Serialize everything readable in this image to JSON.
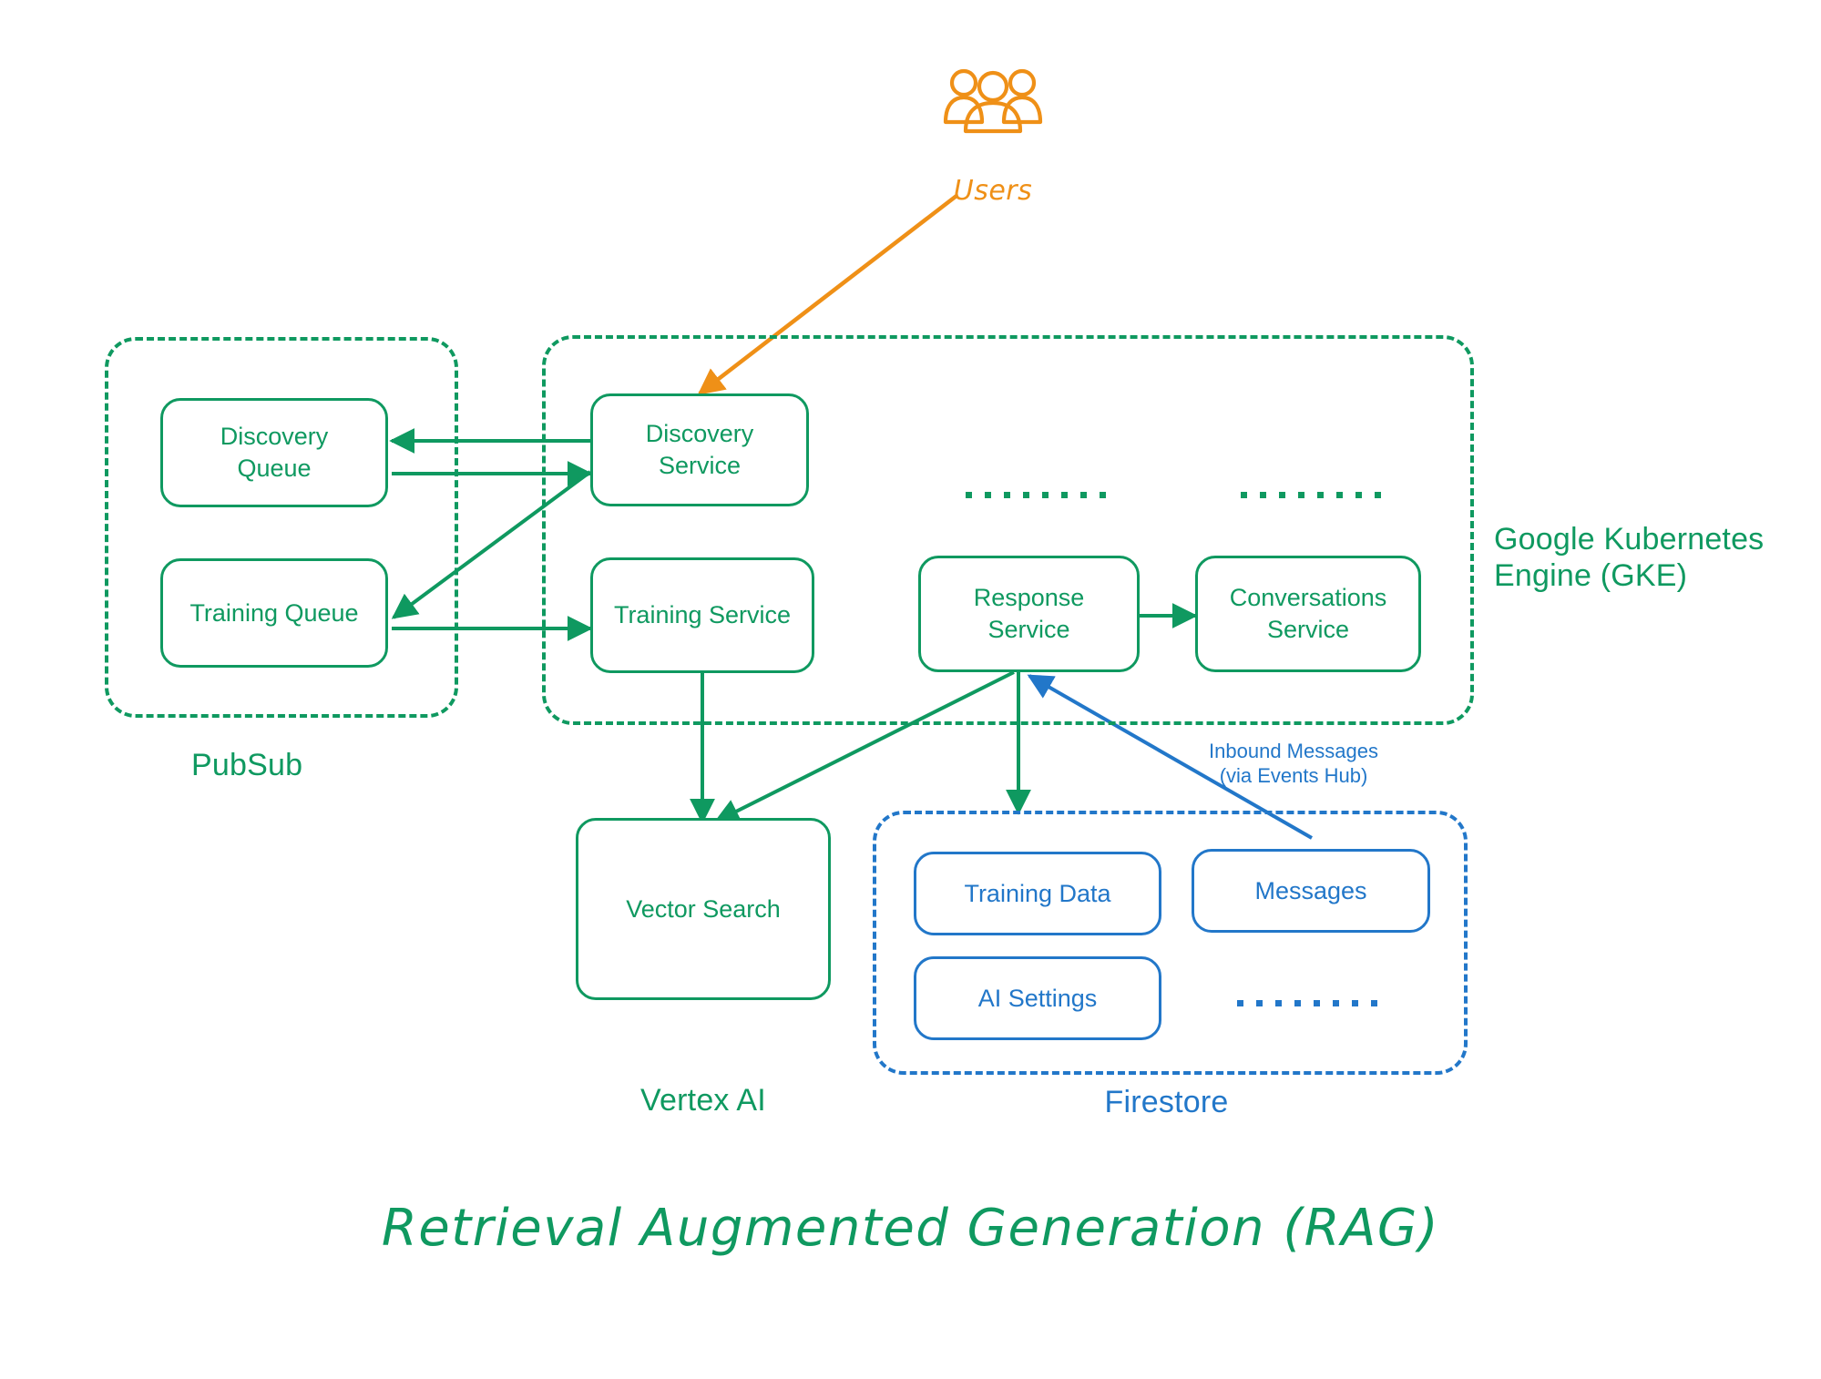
{
  "title": "Retrieval Augmented Generation (RAG)",
  "colors": {
    "green": "#0f9960",
    "blue": "#2277c9",
    "orange": "#ef9017"
  },
  "actors": {
    "users": {
      "label": "Users",
      "icon": "users-group-icon"
    }
  },
  "groups": {
    "pubsub": {
      "label": "PubSub",
      "color": "#0f9960",
      "nodes": [
        {
          "label": "Discovery\nQueue"
        },
        {
          "label": "Training Queue"
        }
      ]
    },
    "gke": {
      "label": "Google Kubernetes\nEngine (GKE)",
      "color": "#0f9960",
      "nodes": [
        {
          "label": "Discovery\nService"
        },
        {
          "label": "Training Service"
        },
        {
          "label": "Response\nService"
        },
        {
          "label": "Conversations\nService"
        }
      ],
      "ellipsis": [
        "........",
        "........"
      ]
    },
    "vertex": {
      "label": "Vertex AI",
      "color": "#0f9960",
      "nodes": [
        {
          "label": "Vector Search"
        }
      ]
    },
    "firestore": {
      "label": "Firestore",
      "color": "#2277c9",
      "nodes": [
        {
          "label": "Training Data"
        },
        {
          "label": "Messages"
        },
        {
          "label": "AI Settings"
        }
      ],
      "ellipsis": [
        "........"
      ]
    }
  },
  "edges": {
    "inbound_messages": {
      "caption": "Inbound Messages\n(via Events Hub)"
    }
  }
}
